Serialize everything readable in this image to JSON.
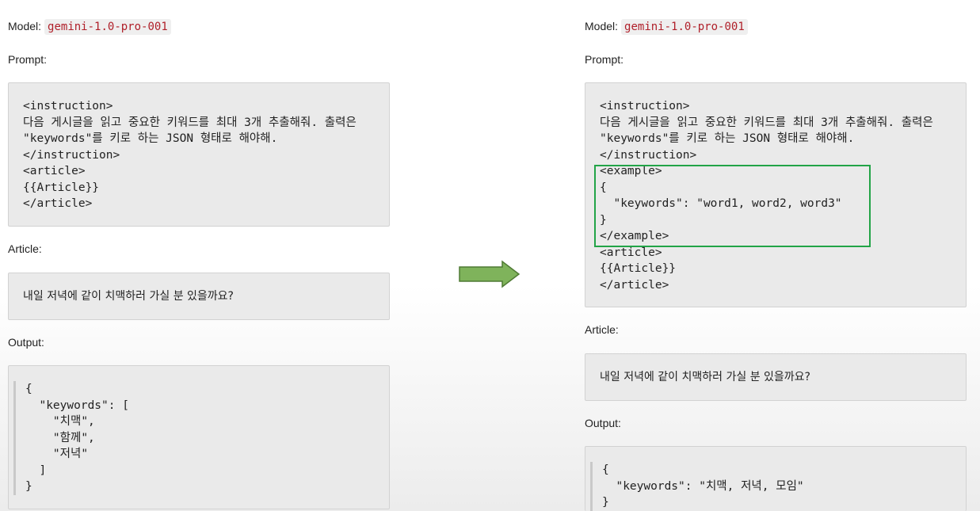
{
  "left": {
    "model_label": "Model:",
    "model_value": "gemini-1.0-pro-001",
    "prompt_label": "Prompt:",
    "prompt_code": "<instruction>\n다음 게시글을 읽고 중요한 키워드를 최대 3개 추출해줘. 출력은\n\"keywords\"를 키로 하는 JSON 형태로 해야해.\n</instruction>\n<article>\n{{Article}}\n</article>",
    "article_label": "Article:",
    "article_text": "내일 저녁에 같이 치맥하러 가실 분 있을까요?",
    "output_label": "Output:",
    "output_code": "{\n  \"keywords\": [\n    \"치맥\",\n    \"함께\",\n    \"저녁\"\n  ]\n}"
  },
  "right": {
    "model_label": "Model:",
    "model_value": "gemini-1.0-pro-001",
    "prompt_label": "Prompt:",
    "prompt_code": "<instruction>\n다음 게시글을 읽고 중요한 키워드를 최대 3개 추출해줘. 출력은\n\"keywords\"를 키로 하는 JSON 형태로 해야해.\n</instruction>\n<example>\n{\n  \"keywords\": \"word1, word2, word3\"\n}\n</example>\n<article>\n{{Article}}\n</article>",
    "article_label": "Article:",
    "article_text": "내일 저녁에 같이 치맥하러 가실 분 있을까요?",
    "output_label": "Output:",
    "output_code": "{\n  \"keywords\": \"치맥, 저녁, 모임\"\n}"
  },
  "colors": {
    "arrow_fill": "#7fb35b",
    "arrow_stroke": "#4f7a34",
    "highlight_border": "#22a447",
    "model_value_text": "#b0202a"
  },
  "icons": {
    "transition": "right-arrow-icon"
  }
}
